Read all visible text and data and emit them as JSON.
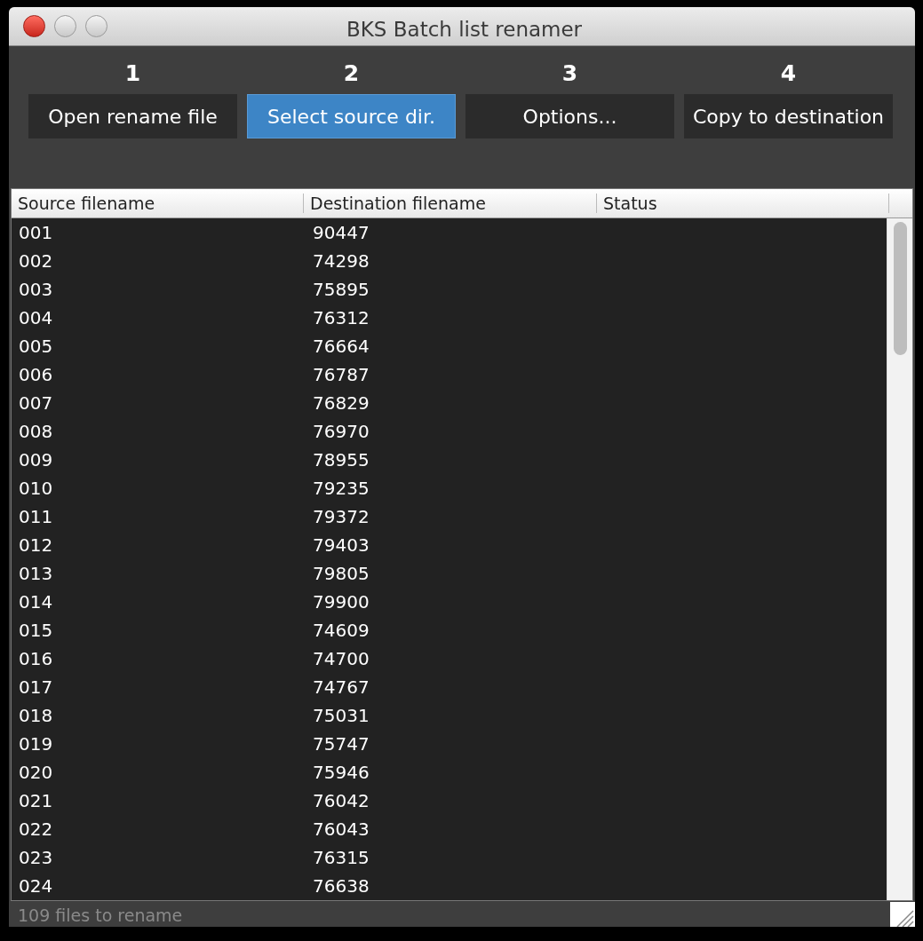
{
  "window": {
    "title": "BKS Batch list renamer"
  },
  "steps": [
    {
      "number": "1",
      "label": "Open rename file",
      "selected": false
    },
    {
      "number": "2",
      "label": "Select source dir.",
      "selected": true
    },
    {
      "number": "3",
      "label": "Options...",
      "selected": false
    },
    {
      "number": "4",
      "label": "Copy to destination",
      "selected": false
    }
  ],
  "table": {
    "columns": [
      "Source filename",
      "Destination filename",
      "Status"
    ],
    "rows": [
      {
        "source": "001",
        "destination": "90447"
      },
      {
        "source": "002",
        "destination": "74298"
      },
      {
        "source": "003",
        "destination": "75895"
      },
      {
        "source": "004",
        "destination": "76312"
      },
      {
        "source": "005",
        "destination": "76664"
      },
      {
        "source": "006",
        "destination": "76787"
      },
      {
        "source": "007",
        "destination": "76829"
      },
      {
        "source": "008",
        "destination": "76970"
      },
      {
        "source": "009",
        "destination": "78955"
      },
      {
        "source": "010",
        "destination": "79235"
      },
      {
        "source": "011",
        "destination": "79372"
      },
      {
        "source": "012",
        "destination": "79403"
      },
      {
        "source": "013",
        "destination": "79805"
      },
      {
        "source": "014",
        "destination": "79900"
      },
      {
        "source": "015",
        "destination": "74609"
      },
      {
        "source": "016",
        "destination": "74700"
      },
      {
        "source": "017",
        "destination": "74767"
      },
      {
        "source": "018",
        "destination": "75031"
      },
      {
        "source": "019",
        "destination": "75747"
      },
      {
        "source": "020",
        "destination": "75946"
      },
      {
        "source": "021",
        "destination": "76042"
      },
      {
        "source": "022",
        "destination": "76043"
      },
      {
        "source": "023",
        "destination": "76315"
      },
      {
        "source": "024",
        "destination": "76638"
      }
    ]
  },
  "status_bar": {
    "text": "109 files to rename"
  }
}
